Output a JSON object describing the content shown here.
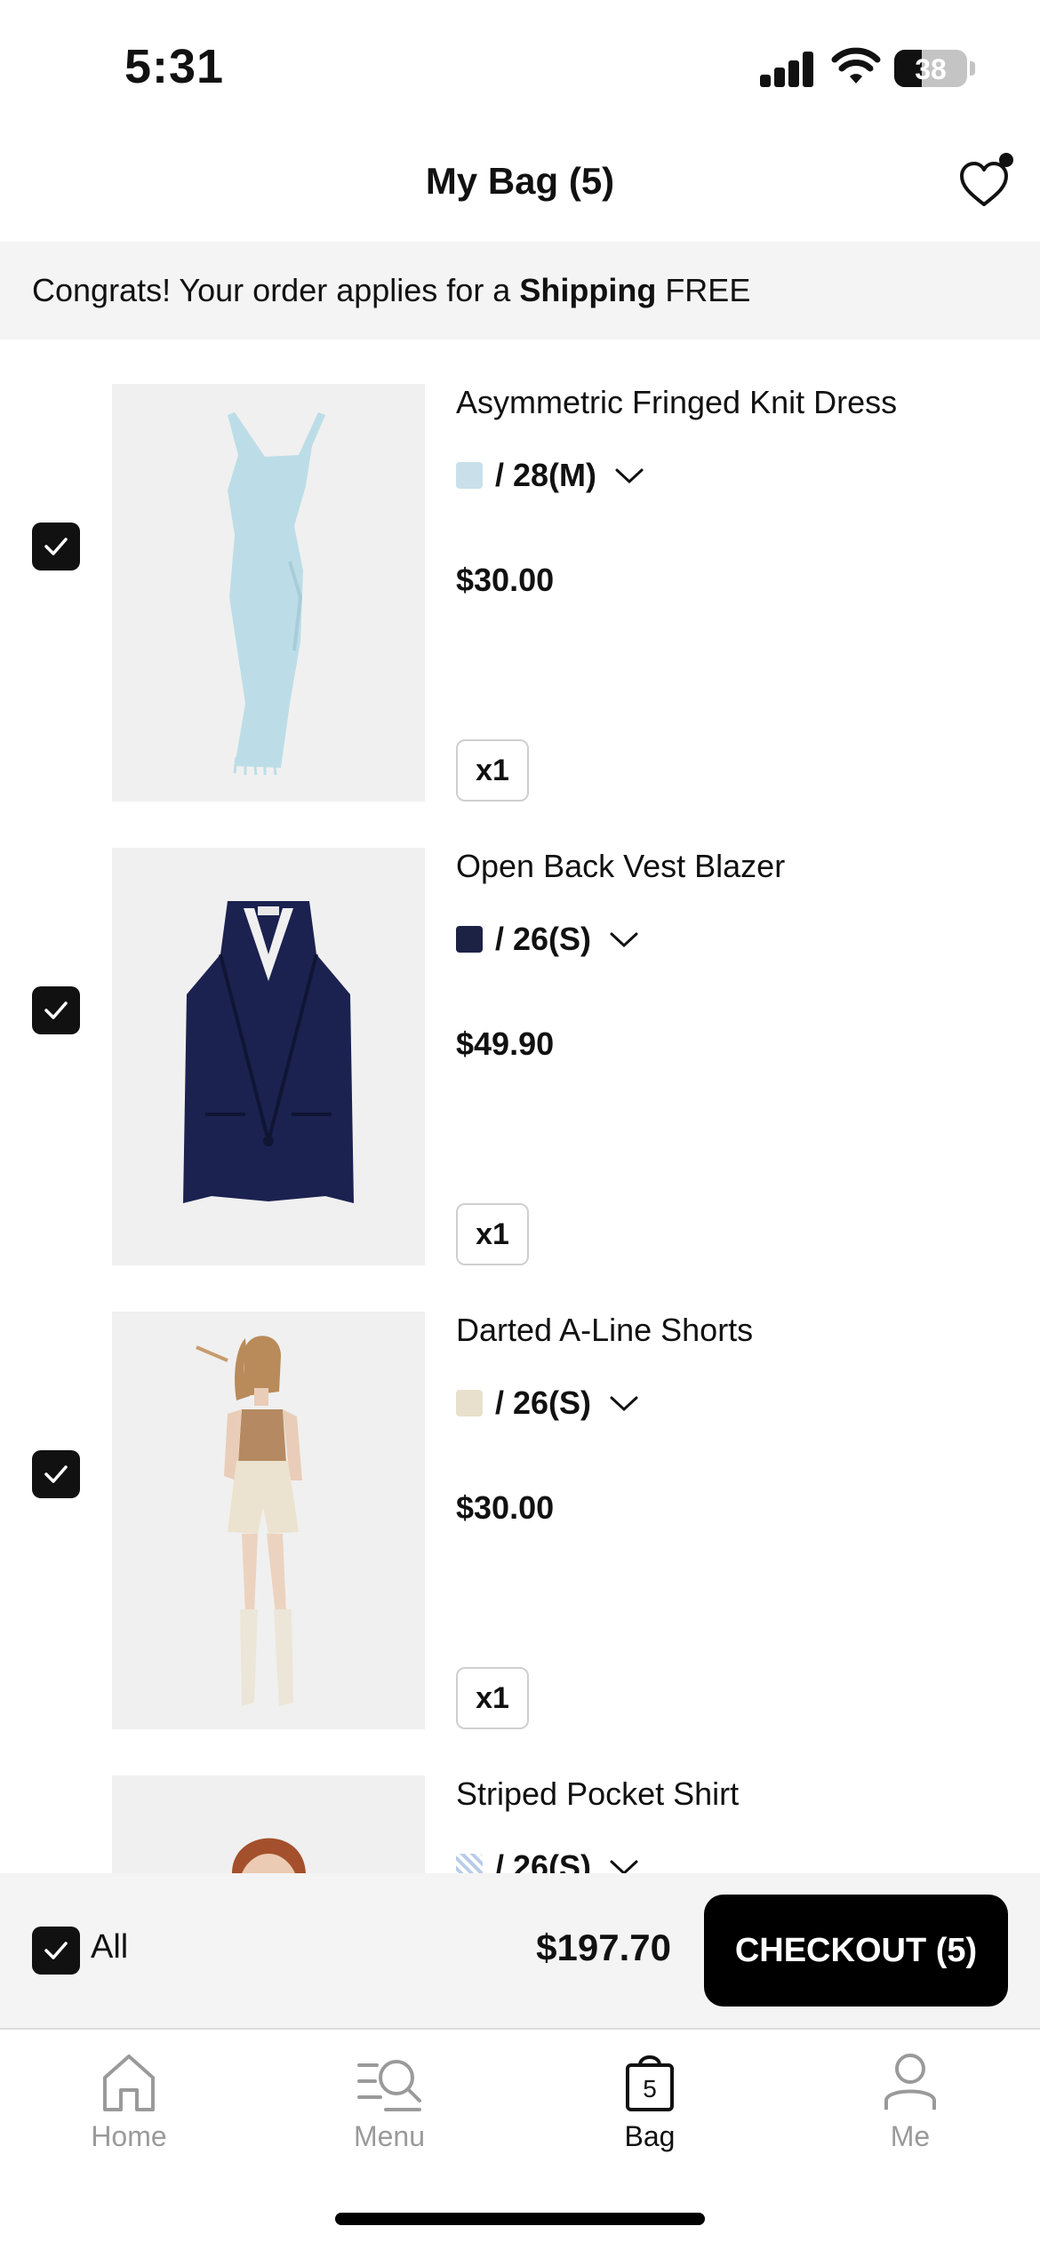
{
  "status_bar": {
    "time": "5:31",
    "battery": "38"
  },
  "header": {
    "title": "My Bag (5)"
  },
  "promo": {
    "prefix": "Congrats! Your order applies for a ",
    "bold": "Shipping",
    "suffix": " FREE"
  },
  "items": [
    {
      "name": "Asymmetric Fringed Knit Dress",
      "variant": "/ 28(M)",
      "swatch_color": "#c9e0ea",
      "price": "$30.00",
      "qty": "x1",
      "checked": true
    },
    {
      "name": "Open Back Vest Blazer",
      "variant": "/ 26(S)",
      "swatch_color": "#1b2244",
      "price": "$49.90",
      "qty": "x1",
      "checked": true
    },
    {
      "name": "Darted A-Line Shorts",
      "variant": "/ 26(S)",
      "swatch_color": "#e8e0cc",
      "price": "$30.00",
      "qty": "x1",
      "checked": true
    },
    {
      "name": "Striped Pocket Shirt",
      "variant": "/ 26(S)",
      "swatch_color": "#b9cde8",
      "price": "",
      "qty": "",
      "checked": true
    }
  ],
  "checkout": {
    "all_label": "All",
    "total": "$197.70",
    "button_label": "CHECKOUT (5)"
  },
  "tabbar": {
    "tabs": [
      {
        "label": "Home",
        "icon": "home-icon",
        "active": false
      },
      {
        "label": "Menu",
        "icon": "menu-search-icon",
        "active": false
      },
      {
        "label": "Bag",
        "icon": "bag-icon",
        "active": true,
        "badge": "5"
      },
      {
        "label": "Me",
        "icon": "user-icon",
        "active": false
      }
    ]
  }
}
